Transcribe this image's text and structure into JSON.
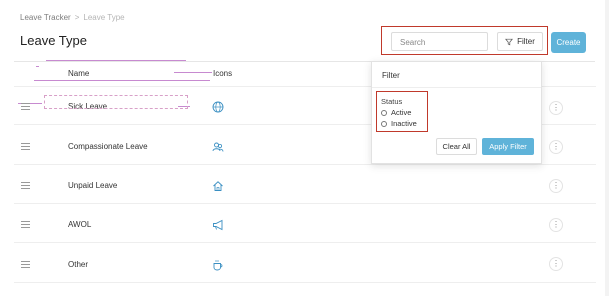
{
  "breadcrumb": {
    "items": [
      "Leave Tracker",
      "Leave Type"
    ],
    "separator": ">"
  },
  "page": {
    "title": "Leave Type"
  },
  "toolbar": {
    "search_placeholder": "Search",
    "filter_label": "Filter",
    "create_label": "Create",
    "accent_color": "#5fb3d9"
  },
  "table": {
    "columns": [
      "Name",
      "Icons"
    ],
    "rows": [
      {
        "name": "Sick Leave",
        "icon": "globe-icon"
      },
      {
        "name": "Compassionate Leave",
        "icon": "people-icon"
      },
      {
        "name": "Unpaid Leave",
        "icon": "home-icon"
      },
      {
        "name": "AWOL",
        "icon": "megaphone-icon"
      },
      {
        "name": "Other",
        "icon": "coffee-cup-icon"
      }
    ],
    "row_menu_glyph": "⋮"
  },
  "filter_popover": {
    "title": "Filter",
    "status_label": "Status",
    "options": [
      "Active",
      "Inactive"
    ],
    "clear_label": "Clear All",
    "apply_label": "Apply Filter"
  }
}
